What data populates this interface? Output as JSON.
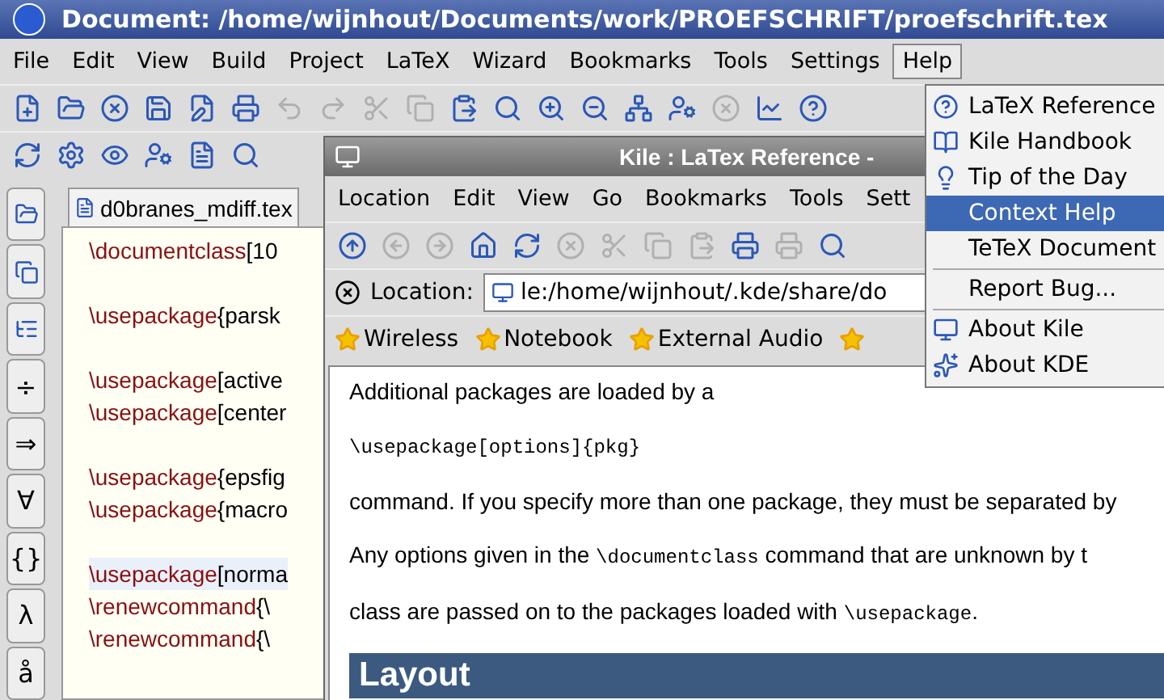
{
  "window": {
    "title": "Document: /home/wijnhout/Documents/work/PROEFSCHRIFT/proefschrift.tex"
  },
  "menu": [
    {
      "label": "File",
      "selected": false
    },
    {
      "label": "Edit",
      "selected": false
    },
    {
      "label": "View",
      "selected": false
    },
    {
      "label": "Build",
      "selected": false
    },
    {
      "label": "Project",
      "selected": false
    },
    {
      "label": "LaTeX",
      "selected": false
    },
    {
      "label": "Wizard",
      "selected": false
    },
    {
      "label": "Bookmarks",
      "selected": false
    },
    {
      "label": "Tools",
      "selected": false
    },
    {
      "label": "Settings",
      "selected": false
    },
    {
      "label": "Help",
      "selected": true
    }
  ],
  "toolbar": [
    {
      "disabled": false
    },
    {
      "disabled": false
    },
    {
      "disabled": false
    },
    {
      "disabled": false
    },
    {
      "disabled": false
    },
    {
      "disabled": false
    },
    {
      "disabled": true
    },
    {
      "disabled": true
    },
    {
      "disabled": true
    },
    {
      "disabled": true
    },
    {
      "disabled": false
    },
    {
      "disabled": false
    },
    {
      "disabled": false
    },
    {
      "disabled": false
    },
    {
      "disabled": false
    },
    {
      "disabled": false
    },
    {
      "disabled": true
    },
    {
      "disabled": false
    },
    {
      "disabled": false
    }
  ],
  "sidebar": [
    "÷",
    "⇒",
    "∀",
    "{}",
    "λ",
    "å"
  ],
  "editor": {
    "tab": "d0branes_mdiff.tex",
    "lines": [
      {
        "kind": "code",
        "cmd": "\\documentclass",
        "arg": "[10",
        "current": false
      },
      {
        "kind": "blank"
      },
      {
        "kind": "code",
        "cmd": "\\usepackage",
        "arg": "{parsk",
        "current": false
      },
      {
        "kind": "blank"
      },
      {
        "kind": "code",
        "cmd": "\\usepackage",
        "arg": "[active",
        "current": false
      },
      {
        "kind": "code",
        "cmd": "\\usepackage",
        "arg": "[center",
        "current": false
      },
      {
        "kind": "blank"
      },
      {
        "kind": "code",
        "cmd": "\\usepackage",
        "arg": "{epsfig",
        "current": false
      },
      {
        "kind": "code",
        "cmd": "\\usepackage",
        "arg": "{macro",
        "current": false
      },
      {
        "kind": "blank"
      },
      {
        "kind": "code",
        "cmd": "\\usepackage",
        "arg": "[norma",
        "current": true
      },
      {
        "kind": "code",
        "cmd": "\\renewcommand",
        "arg": "{\\",
        "current": false
      },
      {
        "kind": "code",
        "cmd": "\\renewcommand",
        "arg": "{\\",
        "current": false
      }
    ]
  },
  "reference_window": {
    "title": "Kile : LaTex Reference -",
    "menu": [
      "Location",
      "Edit",
      "View",
      "Go",
      "Bookmarks",
      "Tools",
      "Sett"
    ],
    "toolbar": [
      {
        "disabled": false
      },
      {
        "disabled": true
      },
      {
        "disabled": true
      },
      {
        "disabled": false
      },
      {
        "disabled": false
      },
      {
        "disabled": true
      },
      {
        "disabled": true
      },
      {
        "disabled": true
      },
      {
        "disabled": true
      },
      {
        "disabled": false
      },
      {
        "disabled": true
      },
      {
        "disabled": false
      }
    ],
    "location_label": "Location:",
    "location": "le:/home/wijnhout/.kde/share/do",
    "bookmarks": [
      "Wireless",
      "Notebook",
      "External Audio"
    ],
    "content": [
      {
        "kind": "text",
        "parts": [
          {
            "kind": "plain",
            "text": "Additional packages are loaded by a"
          }
        ]
      },
      {
        "kind": "text",
        "parts": [
          {
            "kind": "code",
            "text": "\\usepackage[options]{pkg}"
          }
        ]
      },
      {
        "kind": "text",
        "parts": [
          {
            "kind": "plain",
            "text": "command. If you specify more than one package, they must be separated by"
          }
        ]
      },
      {
        "kind": "text",
        "parts": [
          {
            "kind": "plain",
            "text": "Any options given in the "
          },
          {
            "kind": "code",
            "text": "\\documentclass"
          },
          {
            "kind": "plain",
            "text": " command that are unknown by t"
          }
        ]
      },
      {
        "kind": "text",
        "parts": [
          {
            "kind": "plain",
            "text": "class are passed on to the packages loaded with "
          },
          {
            "kind": "code",
            "text": "\\usepackage"
          },
          {
            "kind": "plain",
            "text": "."
          }
        ]
      },
      {
        "kind": "heading",
        "parts": [
          {
            "kind": "plain",
            "text": "Layout"
          }
        ]
      }
    ]
  },
  "help_menu": [
    {
      "kind": "item",
      "label": "LaTeX Reference",
      "selected": false
    },
    {
      "kind": "item",
      "label": "Kile Handbook",
      "selected": false
    },
    {
      "kind": "item",
      "label": "Tip of the Day",
      "selected": false
    },
    {
      "kind": "item",
      "label": "Context Help",
      "selected": true
    },
    {
      "kind": "item",
      "label": "TeTeX Document",
      "selected": false
    },
    {
      "kind": "separator"
    },
    {
      "kind": "item",
      "label": "Report Bug...",
      "selected": false
    },
    {
      "kind": "separator"
    },
    {
      "kind": "item",
      "label": "About Kile",
      "selected": false
    },
    {
      "kind": "item",
      "label": "About KDE",
      "selected": false
    }
  ]
}
